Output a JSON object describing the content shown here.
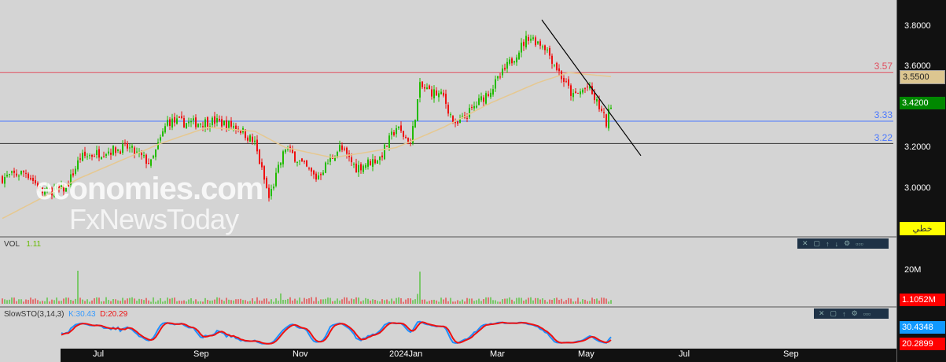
{
  "price_axis": {
    "ticks": [
      "3.8000",
      "3.6000",
      "3.2000",
      "3.0000"
    ],
    "last_price": "3.4200",
    "ma_value": "3.5500",
    "mode_button": "خطي"
  },
  "levels": [
    {
      "label": "3.57",
      "value": 3.57,
      "color": "#e05060"
    },
    {
      "label": "3.33",
      "value": 3.33,
      "color": "#4a78ff"
    },
    {
      "label": "3.22",
      "value": 3.22,
      "color": "#333333"
    }
  ],
  "volume_panel": {
    "title": "VOL",
    "value": "1.11",
    "tick": "20M",
    "last": "1.1052M"
  },
  "sto_panel": {
    "title": "SlowSTO(3,14,3)",
    "k_label": "K:30.43",
    "d_label": "D:20.29",
    "k_value": "30.4348",
    "d_value": "20.2899"
  },
  "x_axis": [
    "Jul",
    "Sep",
    "Nov",
    "2024Jan",
    "Mar",
    "May",
    "Jul",
    "Sep"
  ],
  "watermark": {
    "line1": "economies.com",
    "line2": "FxNewsToday"
  },
  "toolbar_icons": [
    "close-icon",
    "maximize-icon",
    "up-icon",
    "down-icon",
    "settings-icon",
    "more-icon"
  ],
  "chart_data": {
    "type": "candlestick",
    "ylim": [
      2.78,
      3.9
    ],
    "bars": 259,
    "price_path": [
      [
        0,
        3.05
      ],
      [
        10,
        3.08
      ],
      [
        17,
        2.98
      ],
      [
        27,
        3.0
      ],
      [
        33,
        3.15
      ],
      [
        43,
        3.18
      ],
      [
        53,
        3.2
      ],
      [
        63,
        3.12
      ],
      [
        70,
        3.33
      ],
      [
        80,
        3.32
      ],
      [
        90,
        3.33
      ],
      [
        100,
        3.3
      ],
      [
        107,
        3.22
      ],
      [
        113,
        2.95
      ],
      [
        120,
        3.2
      ],
      [
        133,
        3.05
      ],
      [
        143,
        3.2
      ],
      [
        150,
        3.1
      ],
      [
        160,
        3.15
      ],
      [
        167,
        3.3
      ],
      [
        173,
        3.22
      ],
      [
        177,
        3.5
      ],
      [
        187,
        3.45
      ],
      [
        192,
        3.3
      ],
      [
        200,
        3.4
      ],
      [
        208,
        3.5
      ],
      [
        217,
        3.65
      ],
      [
        223,
        3.75
      ],
      [
        230,
        3.7
      ],
      [
        237,
        3.55
      ],
      [
        242,
        3.45
      ],
      [
        248,
        3.5
      ],
      [
        253,
        3.4
      ],
      [
        256,
        3.32
      ],
      [
        258,
        3.42
      ]
    ],
    "ma_path": [
      [
        0,
        2.85
      ],
      [
        33,
        3.05
      ],
      [
        67,
        3.22
      ],
      [
        87,
        3.3
      ],
      [
        107,
        3.28
      ],
      [
        120,
        3.2
      ],
      [
        140,
        3.15
      ],
      [
        167,
        3.2
      ],
      [
        187,
        3.3
      ],
      [
        207,
        3.42
      ],
      [
        227,
        3.52
      ],
      [
        240,
        3.57
      ],
      [
        258,
        3.55
      ]
    ],
    "trendline": [
      [
        229,
        3.83
      ],
      [
        271,
        3.16
      ]
    ],
    "up_color": "#22bb00",
    "down_color": "#ee1111",
    "ma_color": "#e6c890"
  }
}
